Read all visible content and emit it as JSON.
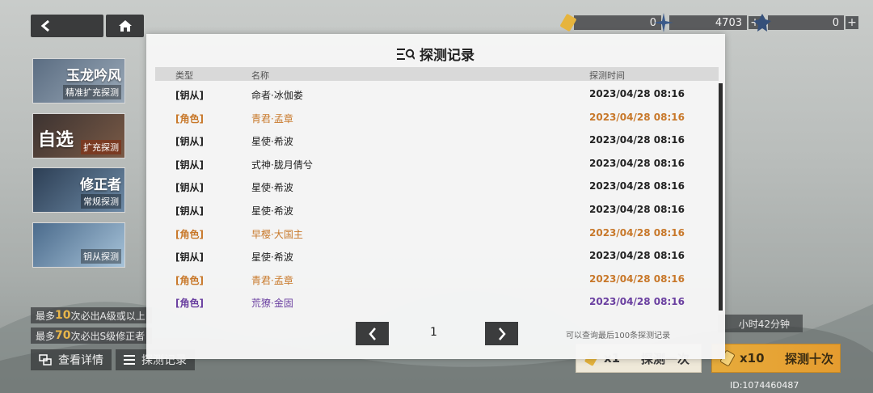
{
  "colors": {
    "servant": "#222222",
    "role_orange": "#c8782a",
    "role_purple": "#6a3fa0"
  },
  "currency": [
    {
      "icon": "ticket-icon",
      "value": "0"
    },
    {
      "icon": "star-crystal-icon",
      "value": "4703"
    },
    {
      "icon": "gem-icon",
      "value": "0"
    }
  ],
  "left_banners": [
    {
      "title": "玉龙吟风",
      "sub": "精准扩充探测"
    },
    {
      "title": "自选",
      "sub": "扩充探测"
    },
    {
      "title": "修正者",
      "sub": "常规探测"
    },
    {
      "title": "",
      "sub": "钥从探测"
    }
  ],
  "info": {
    "line1_prefix": "最多",
    "line1_num": "10",
    "line1_suffix": "次必出A级或以上",
    "line2_prefix": "最多",
    "line2_num": "70",
    "line2_suffix": "次必出S级修正者"
  },
  "bottom_buttons": {
    "details": "查看详情",
    "records": "探测记录"
  },
  "timer": "小时42分钟",
  "pull": {
    "single_count": "x1",
    "single_label": "探测一次",
    "ten_count": "x10",
    "ten_label": "探测十次"
  },
  "user_id": "ID:1074460487",
  "modal": {
    "title": "探测记录",
    "headers": {
      "type": "类型",
      "name": "名称",
      "time": "探测时间"
    },
    "rows": [
      {
        "type": "[钥从]",
        "name": "命者·冰伽娄",
        "time": "2023/04/28 08:16",
        "color": "servant"
      },
      {
        "type": "[角色]",
        "name": "青君·孟章",
        "time": "2023/04/28 08:16",
        "color": "role_orange"
      },
      {
        "type": "[钥从]",
        "name": "星使·希波",
        "time": "2023/04/28 08:16",
        "color": "servant"
      },
      {
        "type": "[钥从]",
        "name": "式神·胧月倩兮",
        "time": "2023/04/28 08:16",
        "color": "servant"
      },
      {
        "type": "[钥从]",
        "name": "星使·希波",
        "time": "2023/04/28 08:16",
        "color": "servant"
      },
      {
        "type": "[钥从]",
        "name": "星使·希波",
        "time": "2023/04/28 08:16",
        "color": "servant"
      },
      {
        "type": "[角色]",
        "name": "早樱·大国主",
        "time": "2023/04/28 08:16",
        "color": "role_orange"
      },
      {
        "type": "[钥从]",
        "name": "星使·希波",
        "time": "2023/04/28 08:16",
        "color": "servant"
      },
      {
        "type": "[角色]",
        "name": "青君·孟章",
        "time": "2023/04/28 08:16",
        "color": "role_orange"
      },
      {
        "type": "[角色]",
        "name": "荒獠·金固",
        "time": "2023/04/28 08:16",
        "color": "role_purple"
      }
    ],
    "page": "1",
    "hint": "可以查询最后100条探测记录"
  }
}
